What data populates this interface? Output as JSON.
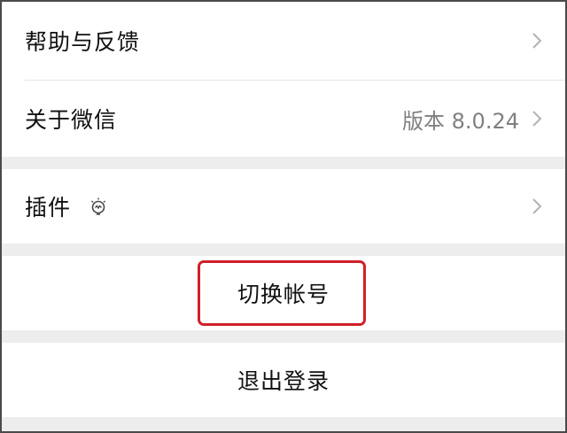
{
  "settings": {
    "help_feedback": {
      "label": "帮助与反馈"
    },
    "about": {
      "label": "关于微信",
      "value": "版本 8.0.24"
    },
    "plugins": {
      "label": "插件",
      "icon": "plugin-bulb-icon"
    },
    "switch_account": {
      "label": "切换帐号"
    },
    "logout": {
      "label": "退出登录"
    }
  },
  "colors": {
    "background": "#ededed",
    "row": "#ffffff",
    "text": "#111111",
    "secondary_text": "#808080",
    "highlight": "#d0202a"
  }
}
